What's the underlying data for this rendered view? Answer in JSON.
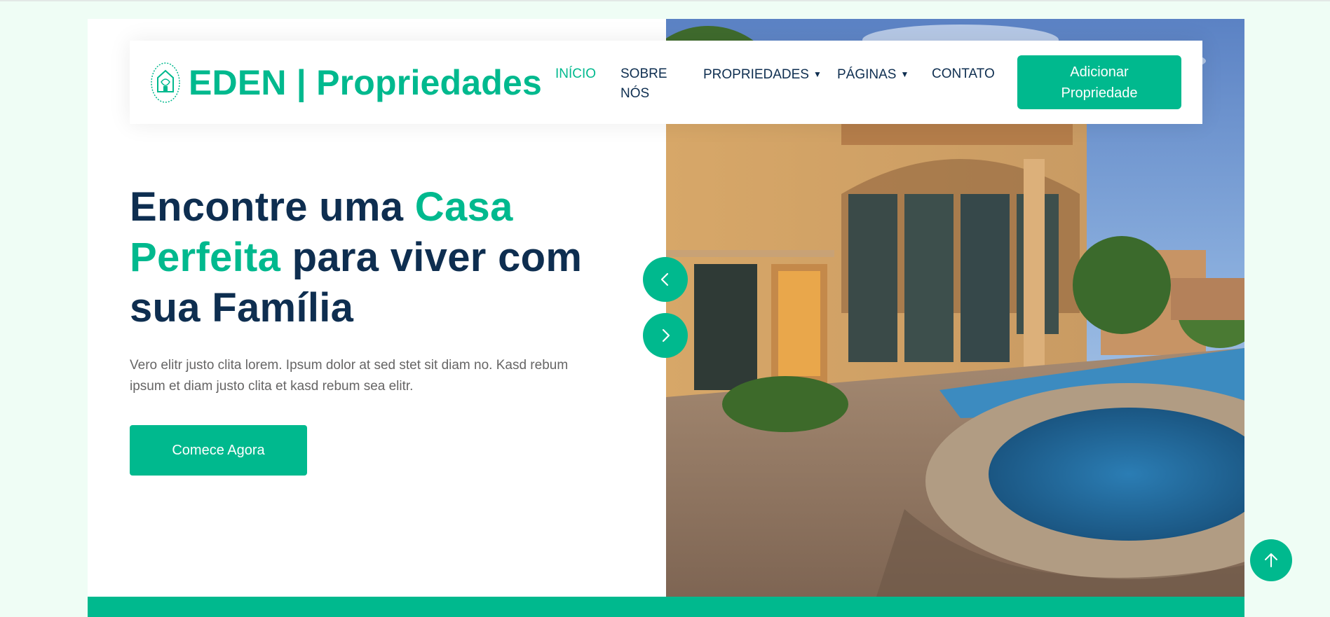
{
  "brand": {
    "name": "EDEN | Propriedades",
    "icon": "house-emblem-icon",
    "color": "#00b98e"
  },
  "nav": {
    "items": [
      {
        "label": "INÍCIO",
        "active": true
      },
      {
        "label": "SOBRE NÓS"
      },
      {
        "label": "PROPRIEDADES",
        "dropdown": true
      },
      {
        "label": "PÁGINAS",
        "dropdown": true
      },
      {
        "label": "CONTATO"
      }
    ],
    "cta": "Adicionar Propriedade"
  },
  "hero": {
    "headline": {
      "part1": "Encontre uma ",
      "accent": "Casa Perfeita",
      "part2": " para viver com sua Família"
    },
    "description": "Vero elitr justo clita lorem. Ipsum dolor at sed stet sit diam no. Kasd rebum ipsum et diam justo clita et kasd rebum sea elitr.",
    "cta": "Comece Agora",
    "image": "luxury-house-with-pool"
  },
  "carousel": {
    "prev_icon": "chevron-left-icon",
    "next_icon": "chevron-right-icon"
  },
  "back_to_top_icon": "arrow-up-icon",
  "colors": {
    "primary": "#00b98e",
    "dark": "#0e2e50",
    "page_bg": "#effdf5"
  }
}
